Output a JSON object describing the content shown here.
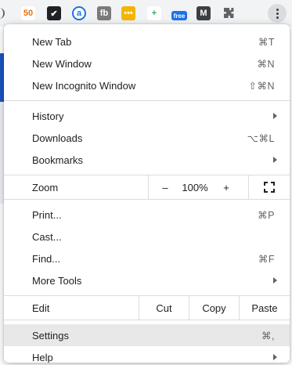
{
  "toolbar": {
    "extensions": [
      {
        "name": "extension-50-icon",
        "text": "50",
        "bg": "#ffffff",
        "fg": "#e8710a"
      },
      {
        "name": "extension-check-icon",
        "text": "✔",
        "bg": "#202124",
        "fg": "#ffffff"
      },
      {
        "name": "extension-a-icon",
        "text": "a",
        "bg": "#ffffff",
        "fg": "#1a73e8"
      },
      {
        "name": "extension-fb-icon",
        "text": "fb",
        "bg": "#7a7a7a",
        "fg": "#ffffff"
      },
      {
        "name": "extension-dots-icon",
        "text": "•••",
        "bg": "#f4b400",
        "fg": "#ffffff"
      },
      {
        "name": "extension-plus-icon",
        "text": "+",
        "bg": "#ffffff",
        "fg": "#34a853"
      },
      {
        "name": "extension-wifi-free-icon",
        "text": "free",
        "bg": "#1a73e8",
        "fg": "#ffffff"
      },
      {
        "name": "extension-m-icon",
        "text": "M",
        "bg": "#3c4043",
        "fg": "#ffffff"
      }
    ]
  },
  "menu": {
    "new_tab": {
      "label": "New Tab",
      "shortcut": "⌘T"
    },
    "new_window": {
      "label": "New Window",
      "shortcut": "⌘N"
    },
    "new_incognito": {
      "label": "New Incognito Window",
      "shortcut": "⇧⌘N"
    },
    "history": {
      "label": "History"
    },
    "downloads": {
      "label": "Downloads",
      "shortcut": "⌥⌘L"
    },
    "bookmarks": {
      "label": "Bookmarks"
    },
    "zoom": {
      "label": "Zoom",
      "minus": "–",
      "level": "100%",
      "plus": "+"
    },
    "print": {
      "label": "Print...",
      "shortcut": "⌘P"
    },
    "cast": {
      "label": "Cast..."
    },
    "find": {
      "label": "Find...",
      "shortcut": "⌘F"
    },
    "more_tools": {
      "label": "More Tools"
    },
    "edit": {
      "label": "Edit",
      "cut": "Cut",
      "copy": "Copy",
      "paste": "Paste"
    },
    "settings": {
      "label": "Settings",
      "shortcut": "⌘,"
    },
    "help": {
      "label": "Help"
    }
  },
  "colors": {
    "accent": "#1a73e8",
    "highlight": "#e8e8e8",
    "separator": "#dadce0"
  }
}
